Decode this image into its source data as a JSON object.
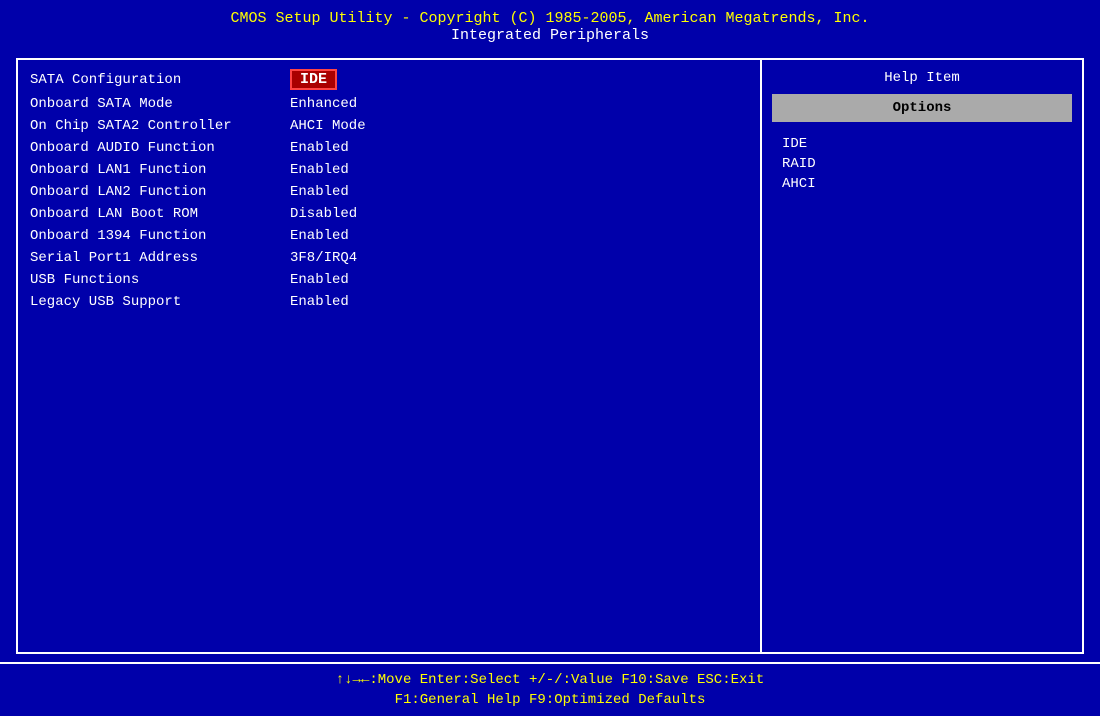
{
  "header": {
    "title": "CMOS Setup Utility - Copyright (C) 1985-2005, American Megatrends, Inc.",
    "subtitle": "Integrated Peripherals"
  },
  "left_panel": {
    "rows": [
      {
        "label": "SATA Configuration",
        "value": "IDE",
        "selected": true
      },
      {
        "label": "Onboard SATA Mode",
        "value": "Enhanced",
        "selected": false
      },
      {
        "label": "On Chip SATA2 Controller",
        "value": "AHCI Mode",
        "selected": false
      },
      {
        "label": "Onboard AUDIO Function",
        "value": "Enabled",
        "selected": false
      },
      {
        "label": "Onboard LAN1 Function",
        "value": "Enabled",
        "selected": false
      },
      {
        "label": "Onboard LAN2 Function",
        "value": "Enabled",
        "selected": false
      },
      {
        "label": "Onboard LAN Boot ROM",
        "value": "Disabled",
        "selected": false
      },
      {
        "label": "Onboard 1394 Function",
        "value": "Enabled",
        "selected": false
      },
      {
        "label": "Serial Port1 Address",
        "value": "3F8/IRQ4",
        "selected": false
      },
      {
        "label": "USB Functions",
        "value": "Enabled",
        "selected": false
      },
      {
        "label": "Legacy USB Support",
        "value": "Enabled",
        "selected": false
      }
    ]
  },
  "right_panel": {
    "help_label": "Help Item",
    "options_label": "Options",
    "options": [
      {
        "label": "IDE"
      },
      {
        "label": "RAID"
      },
      {
        "label": "AHCI"
      }
    ]
  },
  "footer": {
    "line1": "↑↓→←:Move   Enter:Select   +/-/:Value   F10:Save   ESC:Exit",
    "line2": "F1:General Help                F9:Optimized Defaults"
  }
}
